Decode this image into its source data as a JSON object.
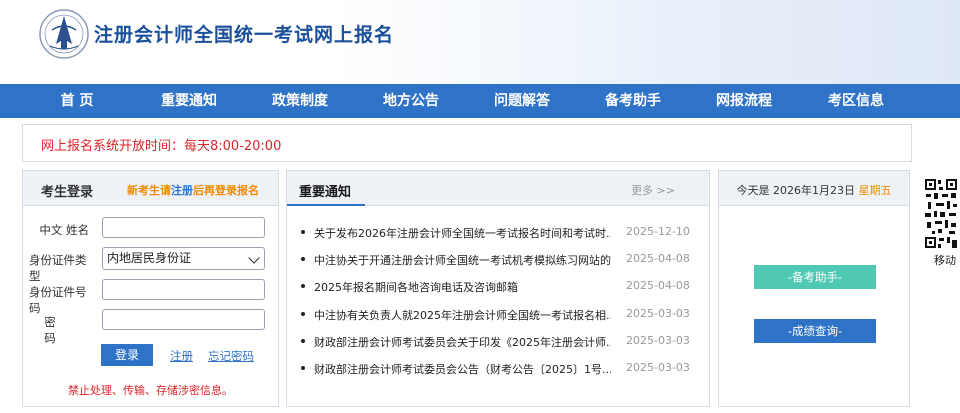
{
  "header": {
    "title": "注册会计师全国统一考试网上报名"
  },
  "nav": [
    "首 页",
    "重要通知",
    "政策制度",
    "地方公告",
    "问题解答",
    "备考助手",
    "网报流程",
    "考区信息"
  ],
  "notice": "网上报名系统开放时间：每天8:00-20:00",
  "login": {
    "title": "考生登录",
    "new_pre": "新考生请",
    "new_link": "注册",
    "new_post": "后再登录报名",
    "name_label": "中文 姓名",
    "idtype_label": "身份证件类型",
    "idtype_value": "内地居民身份证",
    "idno_label": "身份证件号码",
    "pwd_label": "密 码",
    "login_btn": "登录",
    "register_link": "注册",
    "forgot_link": "忘记密码",
    "warning": "禁止处理、传输、存储涉密信息。"
  },
  "news": {
    "title": "重要通知",
    "more": "更多 >>",
    "items": [
      {
        "title": "关于发布2026年注册会计师全国统一考试报名时间和考试时...",
        "date": "2025-12-10"
      },
      {
        "title": "中注协关于开通注册会计师全国统一考试机考模拟练习网站的公...",
        "date": "2025-04-08"
      },
      {
        "title": "2025年报名期间各地咨询电话及咨询邮箱",
        "date": "2025-04-08"
      },
      {
        "title": "中注协有关负责人就2025年注册会计师全国统一考试报名相...",
        "date": "2025-03-03"
      },
      {
        "title": "财政部注册会计师考试委员会关于印发《2025年注册会计师...",
        "date": "2025-03-03"
      },
      {
        "title": "财政部注册会计师考试委员会公告（财考公告〔2025〕1号...",
        "date": "2025-03-03"
      }
    ]
  },
  "side": {
    "date_prefix": "今天是 2026年1月23日",
    "weekday": "星期五",
    "btn1": "-备考助手-",
    "btn2": "-成绩查询-",
    "btn1_color": "#4fc9b4",
    "btn2_color": "#2f73c9"
  },
  "qr": {
    "label": "移动"
  },
  "colors": {
    "nav": "#2f73c9",
    "accent": "#f08a00",
    "alert": "#d8262a"
  }
}
